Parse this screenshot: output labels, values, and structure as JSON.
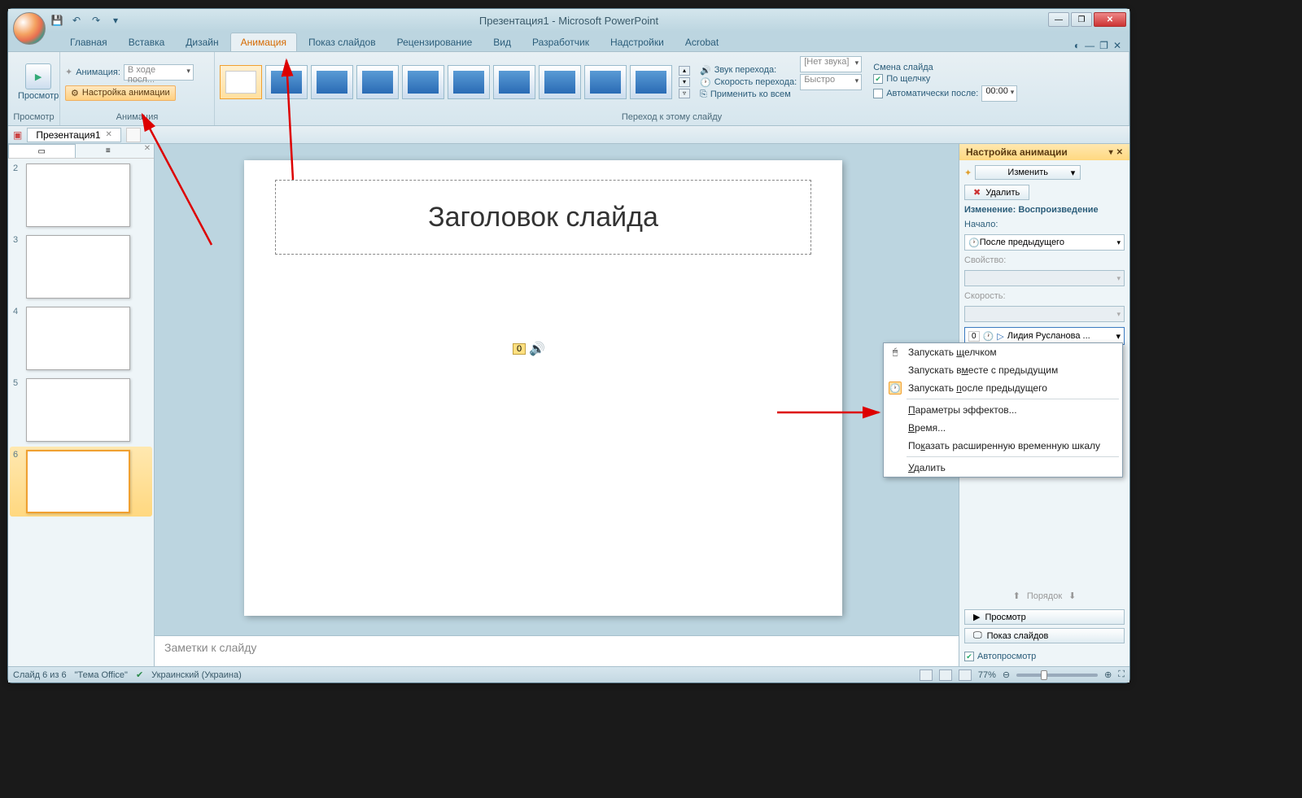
{
  "window": {
    "title": "Презентация1 - Microsoft PowerPoint"
  },
  "tabs": {
    "home": "Главная",
    "insert": "Вставка",
    "design": "Дизайн",
    "animation": "Анимация",
    "slideshow": "Показ слайдов",
    "review": "Рецензирование",
    "view": "Вид",
    "developer": "Разработчик",
    "addins": "Надстройки",
    "acrobat": "Acrobat"
  },
  "ribbon": {
    "preview_btn": "Просмотр",
    "preview_group": "Просмотр",
    "anim_label": "Анимация:",
    "anim_value": "В ходе посл...",
    "custom_anim": "Настройка анимации",
    "anim_group": "Анимация",
    "trans_group": "Переход к этому слайду",
    "sound_label": "Звук перехода:",
    "sound_value": "[Нет звука]",
    "speed_label": "Скорость перехода:",
    "speed_value": "Быстро",
    "apply_all": "Применить ко всем",
    "advance_title": "Смена слайда",
    "on_click": "По щелчку",
    "auto_after": "Автоматически после:",
    "auto_time": "00:00"
  },
  "docbar": {
    "doc": "Презентация1"
  },
  "thumbs": [
    "2",
    "3",
    "4",
    "5",
    "6"
  ],
  "slide": {
    "title_placeholder": "Заголовок слайда",
    "badge": "0"
  },
  "notes": "Заметки к слайду",
  "taskpane": {
    "title": "Настройка анимации",
    "change": "Изменить",
    "delete": "Удалить",
    "section": "Изменение: Воспроизведение",
    "start_label": "Начало:",
    "start_value": "После предыдущего",
    "prop_label": "Свойство:",
    "speed_label": "Скорость:",
    "effect_seq": "0",
    "effect_name": "Лидия Русланова ...",
    "order": "Порядок",
    "preview": "Просмотр",
    "slideshow": "Показ слайдов",
    "autopreview": "Автопросмотр"
  },
  "ctx": {
    "click": "Запускать щелчком",
    "with_prev": "Запускать вместе с предыдущим",
    "after_prev": "Запускать после предыдущего",
    "effect_opts": "Параметры эффектов...",
    "timing": "Время...",
    "timeline": "Показать расширенную временную шкалу",
    "remove": "Удалить"
  },
  "status": {
    "slide": "Слайд 6 из 6",
    "theme": "\"Тема Office\"",
    "lang": "Украинский (Украина)",
    "zoom": "77%"
  }
}
